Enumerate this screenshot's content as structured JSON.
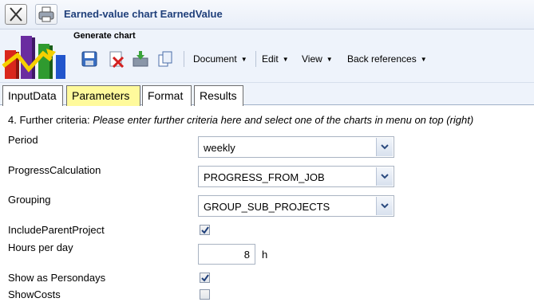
{
  "window": {
    "title": "Earned-value chart EarnedValue"
  },
  "toolbar": {
    "generate_label": "Generate chart",
    "menus": [
      {
        "label": "Document"
      },
      {
        "label": "Edit"
      },
      {
        "label": "View"
      },
      {
        "label": "Back references"
      }
    ]
  },
  "tabs": [
    {
      "label": "InputData",
      "active": false
    },
    {
      "label": "Parameters",
      "active": true
    },
    {
      "label": "Format",
      "active": false
    },
    {
      "label": "Results",
      "active": false
    }
  ],
  "form": {
    "intro_prefix": "4. Further criteria:",
    "intro_hint": "Please enter further criteria here and select one of the charts in menu on top (right)",
    "fields": {
      "period": {
        "label": "Period",
        "value": "weekly"
      },
      "progress_calculation": {
        "label": "ProgressCalculation",
        "value": "PROGRESS_FROM_JOB"
      },
      "grouping": {
        "label": "Grouping",
        "value": "GROUP_SUB_PROJECTS"
      },
      "include_parent_project": {
        "label": "IncludeParentProject",
        "checked": true
      },
      "hours_per_day": {
        "label": "Hours per day",
        "value": "8",
        "unit": "h"
      },
      "show_as_persondays": {
        "label": "Show as Persondays",
        "checked": true
      },
      "show_costs": {
        "label": "ShowCosts",
        "checked": false
      }
    }
  },
  "colors": {
    "active_tab": "#fffa9c",
    "title_text": "#1f3f7a",
    "toolbar_bg": "#eef3fb"
  }
}
